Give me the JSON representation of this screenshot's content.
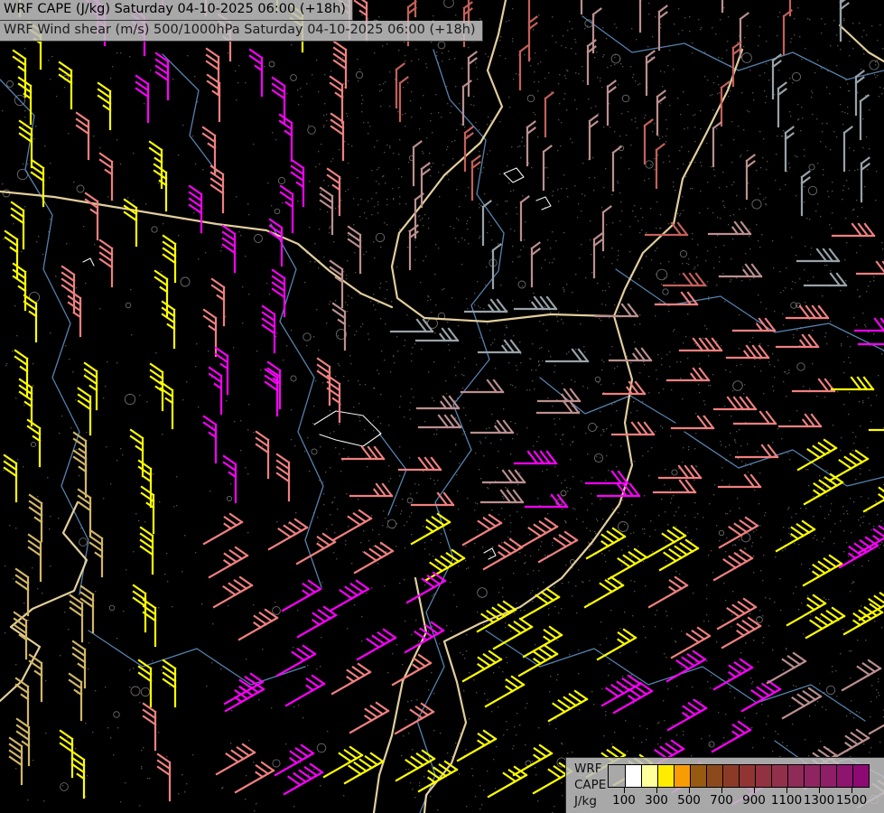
{
  "header": {
    "line1": "WRF CAPE (J/kg) Saturday 04-10-2025 06:00 (+18h)",
    "line2": "WRF Wind shear (m/s) 500/1000hPa Saturday 04-10-2025 06:00 (+18h)"
  },
  "legend": {
    "title_lines": [
      "WRF",
      "CAPE",
      "J/kg"
    ],
    "scale_min": 0,
    "scale_max": 1600,
    "cell_step": 100,
    "cell_colors": [
      null,
      "#ffffff",
      "#ffff9e",
      "#ffec00",
      "#f89c06",
      "#975a13",
      "#8c4a1c",
      "#8c3a28",
      "#913434",
      "#92313f",
      "#92304c",
      "#8e2b57",
      "#8e2560",
      "#8e1e67",
      "#8e156d",
      "#8d0a73"
    ],
    "tick_values": [
      100,
      300,
      500,
      700,
      900,
      1100,
      1300,
      1500
    ]
  },
  "map": {
    "background_color": "#000000",
    "border_color": "#eed9a4",
    "river_color": "#5f8fc0",
    "stipple_color": "#8a8a8a",
    "contour_mark_color": "#ffffff",
    "barb_palette": {
      "Y": "#ffff00",
      "S": "#f08080",
      "M": "#ff00ff",
      "R": "#bc8f8f",
      "G": "#98a2a8",
      "K": "#d2b766",
      "I": "#c4605a"
    },
    "barb_color_grid": [
      "YMMSYSIIIRRRIG",
      "YYMSMSIRIRRIGG",
      "YSYSMSRIRRIRGG",
      "YSYMMRRGRRIRGS",
      "YSYSMRGGGRSSSM",
      "YYYMMSRRRSSSSY",
      "YKYMSSSRMMSSYY",
      "KKYSSSYSSYYSYM",
      "KKYSMMMYYYSSYY",
      "KKYMMSSYYMMMRR",
      "KYSSMYYYYYMMRR"
    ],
    "barb_orient_grid": [
      "vvvvvvnnnnnnnn",
      "vvvvvvnnnnnnnn",
      "vvvvvvnnnnnnnn",
      "vvvvvvnnnnhhhh",
      "vvvvvvhhhhhhhh",
      "vvvvvvhhhhhhhh",
      "vvvvvhhhhhhhdd",
      "vvvddddddddddd",
      "vvvddddddddddd",
      "vvvddddddddddd",
      "vvvddddddddddd"
    ],
    "borders": [
      "560,0 552,38 540,78 556,118 532,158 492,194 466,228 442,258 434,295 440,330 470,352 540,356 610,348 680,350",
      "0,212 60,218 120,228 180,238 240,248 295,255 330,270 365,300 400,325 434,340",
      "680,350 700,420 692,468 700,515 686,558 656,600 622,640 576,672 532,690 492,710 506,755 516,800 500,845 472,880 470,900",
      "822,55 806,100 782,148 756,198 746,248 712,280 692,320 680,350",
      "86,556 70,590 96,620 82,654 36,674 12,694 44,716 24,754 0,776",
      "460,640 472,700 446,754 434,814 420,858 414,900",
      "930,28 962,58 979,68"
    ],
    "rivers": [
      "480,55 498,110 538,155 528,215 558,258 552,300 522,338 542,398 502,448 522,498 482,556 502,618 472,678 492,738 462,798 482,858 465,900",
      "300,248 328,298 310,356 348,418 330,478 358,538 338,598 356,650",
      "645,18 700,58 758,48 818,78 878,58 938,88 979,78",
      "682,298 740,338 798,328 858,368 918,358 979,388",
      "0,88 38,128 28,188 58,238 48,298 78,358 58,418 88,478 68,538 98,598 88,658",
      "758,478 818,518 878,498 938,538 979,528",
      "538,698 598,738 658,718 718,758 778,738 838,778 898,758 958,798",
      "98,698 158,738 218,718 278,758 338,738",
      "598,418 648,458 698,438 748,468",
      "858,820 900,850 940,840 979,860",
      "180,60 220,100 210,150 240,190",
      "420,480 450,520 430,570"
    ],
    "contour_marks": [
      "558,192 572,186 580,196 568,202 558,192",
      "348,470 372,455 402,460 422,480 402,494 372,487 354,481",
      "594,222 604,218 610,228 600,232",
      "92,290 100,286 104,294",
      "536,612 545,607 549,615 541,619"
    ]
  }
}
